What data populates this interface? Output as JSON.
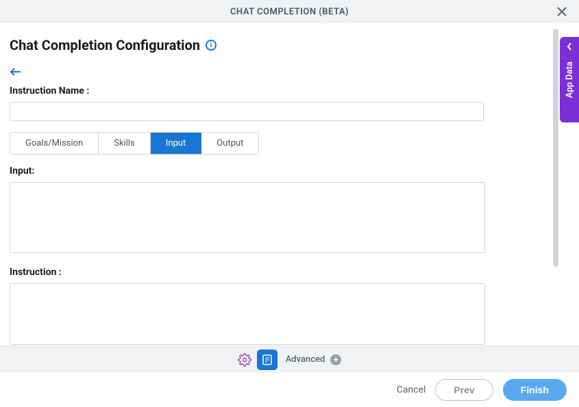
{
  "header": {
    "title": "CHAT COMPLETION (BETA)"
  },
  "page": {
    "title": "Chat Completion Configuration"
  },
  "form": {
    "instructionNameLabel": "Instruction Name :",
    "instructionNameValue": "",
    "inputLabel": "Input:",
    "inputValue": "",
    "instructionLabel": "Instruction :",
    "instructionValue": ""
  },
  "tabs": [
    {
      "label": "Goals/Mission",
      "active": false
    },
    {
      "label": "Skills",
      "active": false
    },
    {
      "label": "Input",
      "active": true
    },
    {
      "label": "Output",
      "active": false
    }
  ],
  "sidebar": {
    "label": "App Data"
  },
  "toolbar": {
    "advancedLabel": "Advanced"
  },
  "actions": {
    "cancel": "Cancel",
    "prev": "Prev",
    "finish": "Finish"
  }
}
